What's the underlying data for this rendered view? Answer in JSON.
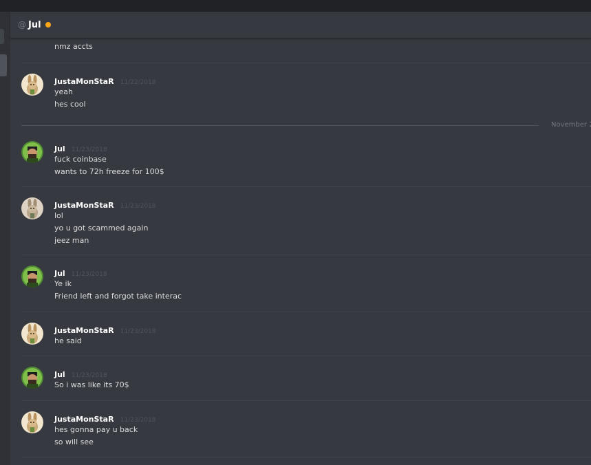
{
  "header": {
    "at_symbol": "@",
    "name": "Jul",
    "status_color": "#faa61a"
  },
  "partial_top_message": "nmz accts",
  "date_divider": "November 2",
  "messages": [
    {
      "author": "JustaMonStaR",
      "timestamp": "11/22/2018",
      "avatar": "rabbit-avatar",
      "lines": [
        "yeah",
        "hes cool"
      ]
    },
    {
      "author": "Jul",
      "timestamp": "11/23/2018",
      "avatar": "green-avatar",
      "lines": [
        "fuck coinbase",
        "wants to 72h freeze for 100$"
      ]
    },
    {
      "author": "JustaMonStaR",
      "timestamp": "11/23/2018",
      "avatar": "rabbit-avatar",
      "lines": [
        "lol",
        "yo u got scammed again",
        "jeez man"
      ]
    },
    {
      "author": "Jul",
      "timestamp": "11/23/2018",
      "avatar": "green-avatar",
      "lines": [
        "Ye ik",
        "Friend left and forgot take interac"
      ]
    },
    {
      "author": "JustaMonStaR",
      "timestamp": "11/23/2018",
      "avatar": "rabbit-avatar",
      "lines": [
        "he said"
      ]
    },
    {
      "author": "Jul",
      "timestamp": "11/23/2018",
      "avatar": "green-avatar",
      "lines": [
        "So i was like its 70$"
      ]
    },
    {
      "author": "JustaMonStaR",
      "timestamp": "11/23/2018",
      "avatar": "rabbit-avatar",
      "lines": [
        "hes gonna pay u back",
        "so will see"
      ]
    }
  ]
}
